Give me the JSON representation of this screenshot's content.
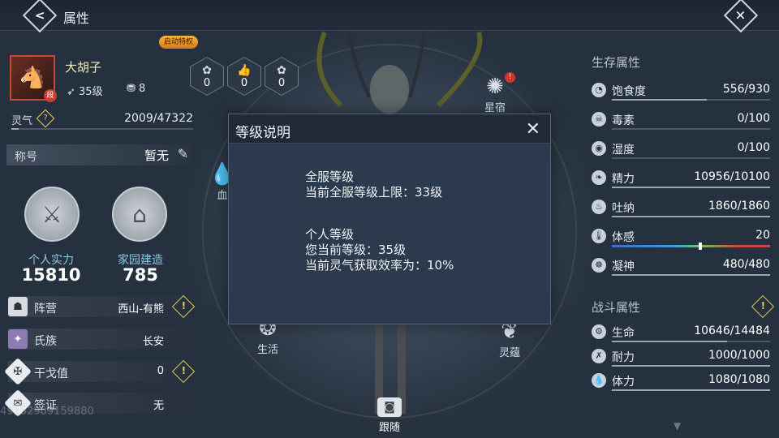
{
  "header": {
    "title": "属性",
    "back_icon": "back-arrow-icon",
    "close_icon": "close-x-icon"
  },
  "player": {
    "badge": "启动特权",
    "name": "大胡子",
    "level": "35级",
    "friend_count": "8",
    "avatar_tag": "段"
  },
  "stat_slots": [
    {
      "value": "0",
      "icon": "flower-icon"
    },
    {
      "value": "0",
      "icon": "thumbs-up-icon"
    },
    {
      "value": "0",
      "icon": "flower-icon"
    }
  ],
  "lingqi": {
    "label": "灵气",
    "value": "2009/47322",
    "fill": 0.042
  },
  "title_row": {
    "label": "称号",
    "value": "暂无"
  },
  "power": {
    "label": "个人实力",
    "value": "15810"
  },
  "home": {
    "label": "家园建造",
    "value": "785"
  },
  "info_rows": [
    {
      "label": "阵营",
      "value": "西山-有熊",
      "warn": true
    },
    {
      "label": "氏族",
      "value": "长安",
      "warn": false
    },
    {
      "label": "干戈值",
      "value": "0",
      "warn": true
    },
    {
      "label": "签证",
      "value": "无",
      "warn": false
    }
  ],
  "watermark": "49152909159880",
  "scene": {
    "constellation": "星宿",
    "blood": "血",
    "life": "生活",
    "lingyun": "灵蕴",
    "follow": "跟随"
  },
  "survival": {
    "title": "生存属性",
    "items": [
      {
        "label": "饱食度",
        "value": "556/930",
        "fill": 0.6
      },
      {
        "label": "毒素",
        "value": "0/100",
        "fill": 0
      },
      {
        "label": "湿度",
        "value": "0/100",
        "fill": 0
      },
      {
        "label": "精力",
        "value": "10956/10100",
        "fill": 1
      },
      {
        "label": "吐纳",
        "value": "1860/1860",
        "fill": 1
      },
      {
        "label": "体感",
        "value": "20",
        "fill": 0.55
      },
      {
        "label": "凝神",
        "value": "480/480",
        "fill": 1
      }
    ]
  },
  "combat": {
    "title": "战斗属性",
    "items": [
      {
        "label": "生命",
        "value": "10646/14484",
        "fill": 0.73
      },
      {
        "label": "耐力",
        "value": "1000/1000",
        "fill": 1
      },
      {
        "label": "体力",
        "value": "1080/1080",
        "fill": 1
      }
    ]
  },
  "modal": {
    "title": "等级说明",
    "server_title": "全服等级",
    "server_desc": "当前全服等级上限：33级",
    "personal_title": "个人等级",
    "personal_level": "您当前等级：35级",
    "personal_rate": "当前灵气获取效率为：10%"
  }
}
